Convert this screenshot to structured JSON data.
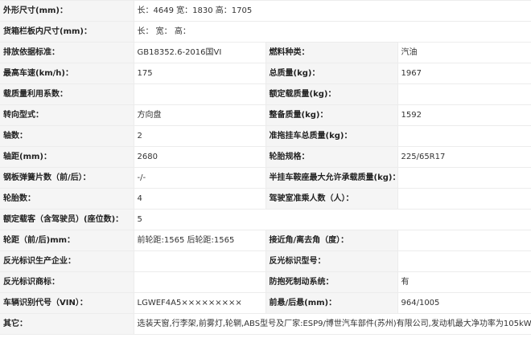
{
  "rows": [
    {
      "l1": "外形尺寸(mm)：",
      "v1": "长：4649 宽：1830 高：1705"
    },
    {
      "l1": "货箱栏板内尺寸(mm)：",
      "v1": "长： 宽： 高："
    },
    {
      "l1": "排放依据标准：",
      "v1": "GB18352.6-2016国VI",
      "l2": "燃料种类：",
      "v2": "汽油"
    },
    {
      "l1": "最高车速(km/h)：",
      "v1": "175",
      "l2": "总质量(kg)：",
      "v2": "1967"
    },
    {
      "l1": "载质量利用系数：",
      "v1": "",
      "l2": "额定载质量(kg)：",
      "v2": ""
    },
    {
      "l1": "转向型式：",
      "v1": "方向盘",
      "l2": "整备质量(kg)：",
      "v2": "1592"
    },
    {
      "l1": "轴数：",
      "v1": "2",
      "l2": "准拖挂车总质量(kg)：",
      "v2": ""
    },
    {
      "l1": "轴距(mm)：",
      "v1": "2680",
      "l2": "轮胎规格：",
      "v2": "225/65R17"
    },
    {
      "l1": "钢板弹簧片数（前/后）：",
      "v1": "-/-",
      "l2": "半挂车鞍座最大允许承载质量(kg)：",
      "v2": ""
    },
    {
      "l1": "轮胎数：",
      "v1": "4",
      "l2": "驾驶室准乘人数（人）：",
      "v2": ""
    },
    {
      "l1": "额定载客（含驾驶员）(座位数)：",
      "v1": "5"
    },
    {
      "l1": "轮距（前/后)mm：",
      "v1": "前轮距:1565 后轮距:1565",
      "l2": "接近角/离去角（度）：",
      "v2": ""
    },
    {
      "l1": "反光标识生产企业：",
      "v1": "",
      "l2": "反光标识型号：",
      "v2": ""
    },
    {
      "l1": "反光标识商标：",
      "v1": "",
      "l2": "防抱死制动系统：",
      "v2": "有"
    },
    {
      "l1": "车辆识别代号（VIN）：",
      "v1": "LGWEF4A5×××××××××",
      "l2": "前悬/后悬(mm)：",
      "v2": "964/1005"
    },
    {
      "l1": "其它：",
      "v1": "选装天窗,行李架,前雾灯,轮辋,ABS型号及厂家:ESP9/博世汽车部件(苏州)有限公司,发动机最大净功率为105kW."
    }
  ]
}
